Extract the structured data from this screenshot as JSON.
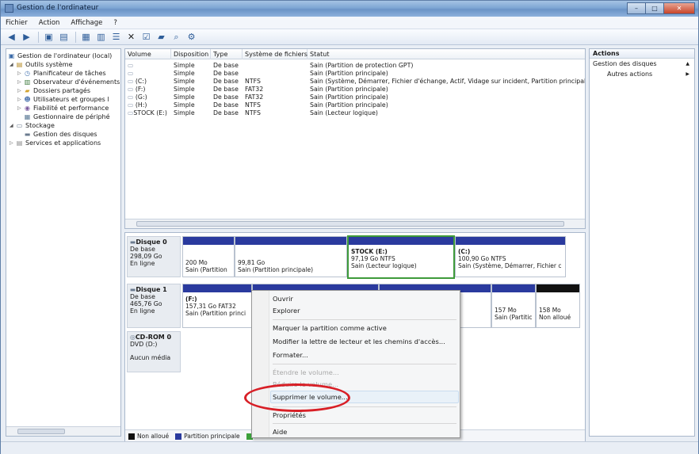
{
  "window": {
    "title": "Gestion de l'ordinateur"
  },
  "menu": [
    "Fichier",
    "Action",
    "Affichage",
    "?"
  ],
  "toolbar_icons": [
    "back-icon",
    "forward-icon",
    "up-icon",
    "show-tree-icon",
    "properties-icon",
    "help-icon",
    "list-icon",
    "delete-icon",
    "check-icon",
    "folder-icon",
    "search-icon",
    "settings-icon"
  ],
  "tree": [
    {
      "label": "Gestion de l'ordinateur (local)",
      "level": 0,
      "icon": "computer-icon"
    },
    {
      "label": "Outils système",
      "level": 1,
      "icon": "tools-icon"
    },
    {
      "label": "Planificateur de tâches",
      "level": 2,
      "icon": "clock-icon"
    },
    {
      "label": "Observateur d'événements",
      "level": 2,
      "icon": "event-icon"
    },
    {
      "label": "Dossiers partagés",
      "level": 2,
      "icon": "shared-folder-icon"
    },
    {
      "label": "Utilisateurs et groupes l",
      "level": 2,
      "icon": "users-icon"
    },
    {
      "label": "Fiabilité et performance",
      "level": 2,
      "icon": "performance-icon"
    },
    {
      "label": "Gestionnaire de périphé",
      "level": 2,
      "icon": "device-icon"
    },
    {
      "label": "Stockage",
      "level": 1,
      "icon": "storage-icon"
    },
    {
      "label": "Gestion des disques",
      "level": 2,
      "icon": "disk-icon"
    },
    {
      "label": "Services et applications",
      "level": 1,
      "icon": "services-icon"
    }
  ],
  "list": {
    "headers": [
      "Volume",
      "Disposition",
      "Type",
      "Système de fichiers",
      "Statut"
    ],
    "rows": [
      [
        "",
        "Simple",
        "De base",
        "",
        "Sain (Partition de protection GPT)"
      ],
      [
        "",
        "Simple",
        "De base",
        "",
        "Sain (Partition principale)"
      ],
      [
        "(C:)",
        "Simple",
        "De base",
        "NTFS",
        "Sain (Système, Démarrer, Fichier d'échange, Actif, Vidage sur incident, Partition principale"
      ],
      [
        "(F:)",
        "Simple",
        "De base",
        "FAT32",
        "Sain (Partition principale)"
      ],
      [
        "(G:)",
        "Simple",
        "De base",
        "FAT32",
        "Sain (Partition principale)"
      ],
      [
        "(H:)",
        "Simple",
        "De base",
        "NTFS",
        "Sain (Partition principale)"
      ],
      [
        "STOCK (E:)",
        "Simple",
        "De base",
        "NTFS",
        "Sain (Lecteur logique)"
      ]
    ]
  },
  "disks": {
    "disk0": {
      "name": "Disque 0",
      "type": "De base",
      "size": "298,09 Go",
      "state": "En ligne"
    },
    "disk1": {
      "name": "Disque 1",
      "type": "De base",
      "size": "465,76 Go",
      "state": "En ligne"
    },
    "cdrom": {
      "name": "CD-ROM 0",
      "drive": "DVD (D:)",
      "media": "Aucun média"
    }
  },
  "partitions": {
    "d0p1": {
      "line1": "",
      "line2": "200 Mo",
      "line3": "Sain (Partition"
    },
    "d0p2": {
      "line1": "",
      "line2": "99,81 Go",
      "line3": "Sain (Partition principale)"
    },
    "d0p3": {
      "line1": "STOCK (E:)",
      "line2": "97,19 Go NTFS",
      "line3": "Sain (Lecteur logique)"
    },
    "d0p4": {
      "line1": "(C:)",
      "line2": "100,90 Go NTFS",
      "line3": "Sain (Système, Démarrer, Fichier c"
    },
    "d1p1": {
      "line1": "(F:)",
      "line2": "157,31 Go FAT32",
      "line3": "Sain (Partition princi"
    },
    "d1p5": {
      "line1": "",
      "line2": "157 Mo",
      "line3": "Sain (Partitic"
    },
    "d1p6": {
      "line1": "",
      "line2": "158 Mo",
      "line3": "Non alloué"
    }
  },
  "legend": [
    "Non alloué",
    "Partition principale",
    "Parti"
  ],
  "actions": {
    "title": "Actions",
    "section": "Gestion des disques",
    "more": "Autres actions"
  },
  "context_menu": {
    "items": [
      {
        "label": "Ouvrir",
        "disabled": false
      },
      {
        "label": "Explorer",
        "disabled": false
      },
      {
        "label": "Marquer la partition comme active",
        "disabled": false
      },
      {
        "label": "Modifier la lettre de lecteur et les chemins d'accès...",
        "disabled": false
      },
      {
        "label": "Formater...",
        "disabled": false
      },
      {
        "label": "Étendre le volume...",
        "disabled": true
      },
      {
        "label": "Réduire le volume...",
        "disabled": true
      },
      {
        "label": "Supprimer le volume...",
        "disabled": false
      },
      {
        "label": "Propriétés",
        "disabled": false
      },
      {
        "label": "Aide",
        "disabled": false
      }
    ]
  },
  "colors": {
    "primary_partition": "#2a3a9e",
    "unallocated": "#111111",
    "logical_drive": "#2a3a9e",
    "selection_outline": "#3e9a3a",
    "highlight_circle": "#d81f26"
  }
}
